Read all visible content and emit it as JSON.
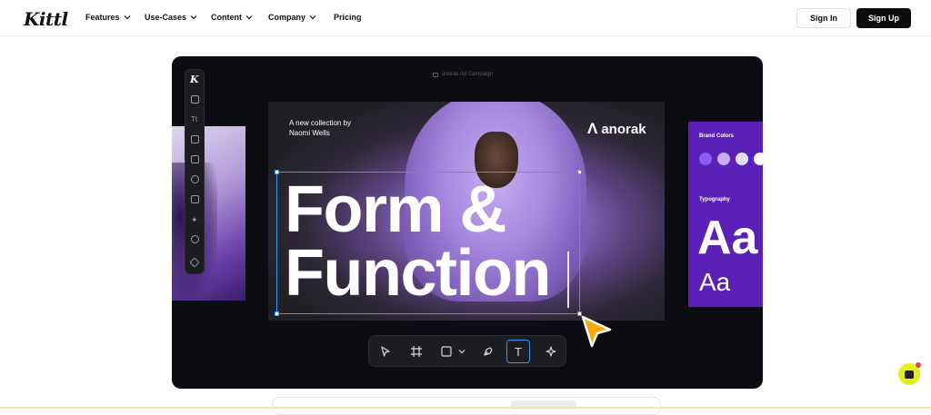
{
  "nav": {
    "logo": "Kittl",
    "items": [
      {
        "label": "Features"
      },
      {
        "label": "Use-Cases"
      },
      {
        "label": "Content"
      },
      {
        "label": "Company"
      },
      {
        "label": "Pricing"
      }
    ],
    "signin_label": "Sign In",
    "signup_label": "Sign Up"
  },
  "editor": {
    "caption": "anorak Ad Campaign",
    "toolbar_logo": "K",
    "toolbar_icons": [
      "layout-icon",
      "text-icon",
      "elements-icon",
      "image-icon",
      "heart-icon",
      "bag-icon",
      "sparkle-icon",
      "chat-bubble-icon",
      "layers-icon"
    ],
    "poster": {
      "subtitle_line1": "A new collection by",
      "subtitle_line2": "Naomi Wells",
      "brand_mark": "Λ",
      "brand_name": "anorak",
      "headline_line1": "Form &",
      "headline_line2": "Function"
    },
    "brand_card": {
      "colors_title": "Brand Colors",
      "swatches": [
        "#8b5cf6",
        "#c4b0f2",
        "#e4dcf9",
        "#ffffff"
      ],
      "typography_title": "Typography",
      "sample_large": "Aa",
      "sample_small": "Aa"
    },
    "bottom_tools": [
      "pointer-icon",
      "frame-icon",
      "rectangle-icon",
      "chevron-down-icon",
      "pen-icon",
      "text-tool-icon",
      "ai-sparkle-icon"
    ],
    "active_tool": "text-tool-icon",
    "text_tool_glyph": "T"
  },
  "colors": {
    "accent_blue": "#3b9bf0",
    "pointer_orange": "#f6a70a",
    "brand_purple": "#5b21b6",
    "chat_yellow": "#e3ee1f"
  }
}
